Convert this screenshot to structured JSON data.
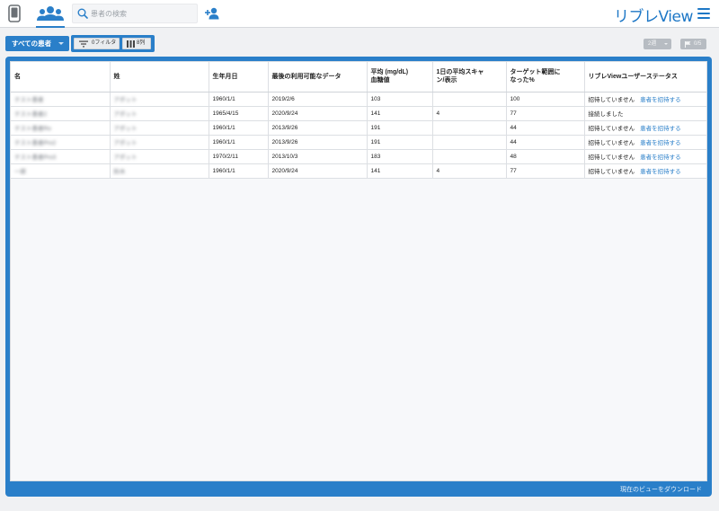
{
  "topbar": {
    "search_placeholder": "患者の検索",
    "brand": "リブレView"
  },
  "toolbar": {
    "all_patients_label": "すべての患者",
    "filters_label": "0フィルタ",
    "columns_label": "8列",
    "weeks_label": "2週",
    "flag_label": "0/5"
  },
  "table": {
    "headers": [
      "名",
      "姓",
      "生年月日",
      "最後の利用可能なデータ",
      "平均 (mg/dL)\n血糖値",
      "1日の平均スキャ\nン/表示",
      "ターゲット範囲に\nなった%",
      "リブレViewユーザーステータス"
    ],
    "rows": [
      {
        "first": "テスト患者",
        "last": "アボット",
        "dob": "1960/1/1",
        "last_data": "2019/2/6",
        "avg": "103",
        "scans": "",
        "target": "100",
        "status": "招待していません",
        "invite": "患者を招待する"
      },
      {
        "first": "テスト患者2",
        "last": "アボット",
        "dob": "1965/4/15",
        "last_data": "2020/9/24",
        "avg": "141",
        "scans": "4",
        "target": "77",
        "status": "接続しました",
        "invite": ""
      },
      {
        "first": "テスト患者Ro",
        "last": "アボット",
        "dob": "1960/1/1",
        "last_data": "2013/9/26",
        "avg": "191",
        "scans": "",
        "target": "44",
        "status": "招待していません",
        "invite": "患者を招待する"
      },
      {
        "first": "テスト患者Pro2",
        "last": "アボット",
        "dob": "1960/1/1",
        "last_data": "2013/9/26",
        "avg": "191",
        "scans": "",
        "target": "44",
        "status": "招待していません",
        "invite": "患者を招待する"
      },
      {
        "first": "テスト患者Pro3",
        "last": "アボット",
        "dob": "1970/2/11",
        "last_data": "2013/10/3",
        "avg": "183",
        "scans": "",
        "target": "48",
        "status": "招待していません",
        "invite": "患者を招待する"
      },
      {
        "first": "一郎",
        "last": "鈴木",
        "dob": "1960/1/1",
        "last_data": "2020/9/24",
        "avg": "141",
        "scans": "4",
        "target": "77",
        "status": "招待していません",
        "invite": "患者を招待する"
      }
    ]
  },
  "footer": {
    "download_label": "現在のビューをダウンロード"
  },
  "colors": {
    "accent": "#2a7fc9",
    "brand": "#1d77c6"
  },
  "icons": [
    "device-icon",
    "patients-icon",
    "search-icon",
    "add-user-icon",
    "menu-icon",
    "filter-icon",
    "columns-icon",
    "flag-icon"
  ]
}
